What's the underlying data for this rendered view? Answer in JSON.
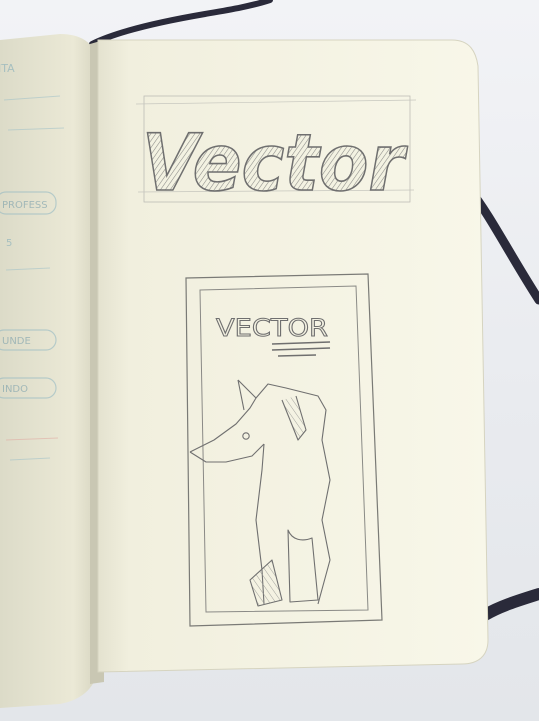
{
  "sketch": {
    "title_lettering": "Vector",
    "poster_heading": "VECTOR",
    "left_page_notes": [
      "ITA",
      "PROFESS",
      "5",
      "UNDE",
      "INDO"
    ]
  },
  "colors": {
    "background": "#eef0f3",
    "paper": "#f5f4e4",
    "pencil": "#6f6f6f",
    "ribbon": "#2a2a3a"
  }
}
